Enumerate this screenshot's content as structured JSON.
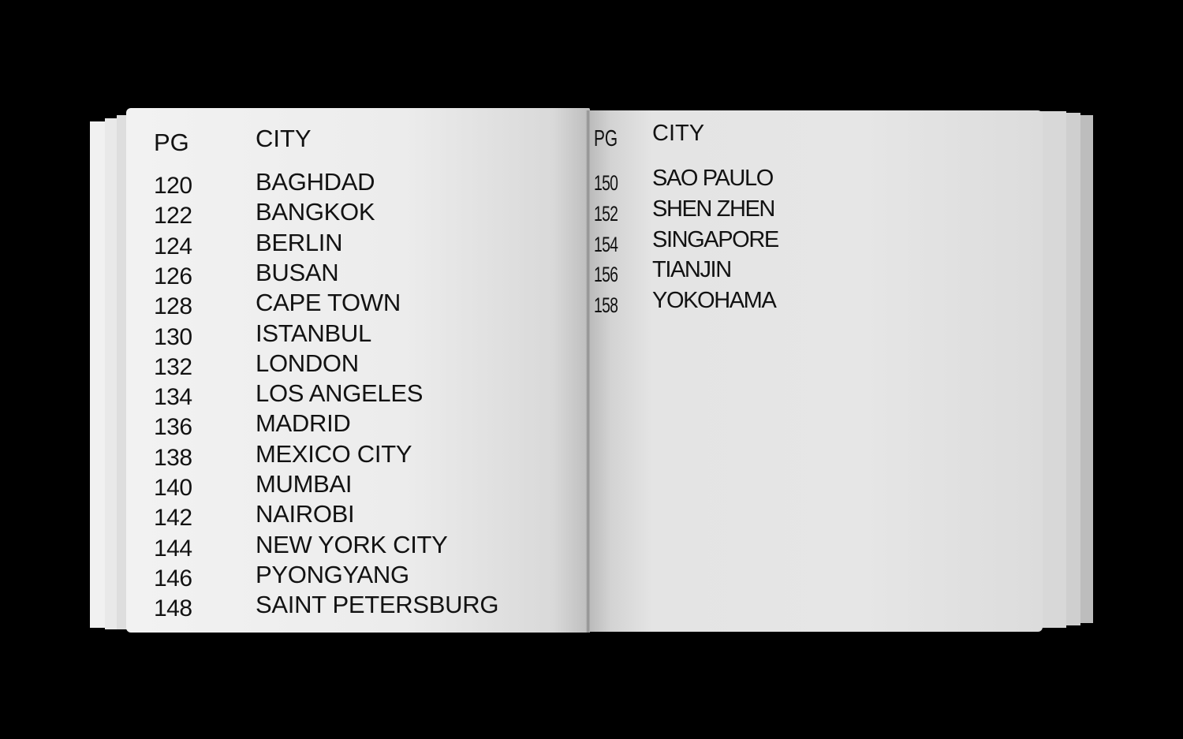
{
  "left_page": {
    "header": {
      "pg": "PG",
      "city": "CITY"
    },
    "entries": [
      {
        "pg": "120",
        "city": "BAGHDAD"
      },
      {
        "pg": "122",
        "city": "BANGKOK"
      },
      {
        "pg": "124",
        "city": "BERLIN"
      },
      {
        "pg": "126",
        "city": "BUSAN"
      },
      {
        "pg": "128",
        "city": "CAPE TOWN"
      },
      {
        "pg": "130",
        "city": "ISTANBUL"
      },
      {
        "pg": "132",
        "city": "LONDON"
      },
      {
        "pg": "134",
        "city": "LOS ANGELES"
      },
      {
        "pg": "136",
        "city": "MADRID"
      },
      {
        "pg": "138",
        "city": "MEXICO CITY"
      },
      {
        "pg": "140",
        "city": "MUMBAI"
      },
      {
        "pg": "142",
        "city": "NAIROBI"
      },
      {
        "pg": "144",
        "city": "NEW YORK CITY"
      },
      {
        "pg": "146",
        "city": "PYONGYANG"
      },
      {
        "pg": "148",
        "city": "SAINT PETERSBURG"
      }
    ]
  },
  "right_page": {
    "header": {
      "pg": "PG",
      "city": "CITY"
    },
    "entries": [
      {
        "pg": "150",
        "city": "SAO PAULO"
      },
      {
        "pg": "152",
        "city": "SHEN ZHEN"
      },
      {
        "pg": "154",
        "city": "SINGAPORE"
      },
      {
        "pg": "156",
        "city": "TIANJIN"
      },
      {
        "pg": "158",
        "city": "YOKOHAMA"
      }
    ]
  },
  "colors": {
    "background": "#000000",
    "paper": "#ececec",
    "ink": "#121212"
  }
}
